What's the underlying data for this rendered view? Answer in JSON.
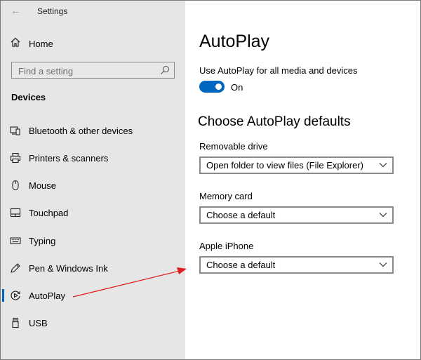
{
  "window": {
    "title": "Settings"
  },
  "sidebar": {
    "home_label": "Home",
    "search_placeholder": "Find a setting",
    "section_title": "Devices",
    "items": [
      {
        "label": "Bluetooth & other devices",
        "icon": "bluetooth-devices-icon"
      },
      {
        "label": "Printers & scanners",
        "icon": "printer-icon"
      },
      {
        "label": "Mouse",
        "icon": "mouse-icon"
      },
      {
        "label": "Touchpad",
        "icon": "touchpad-icon"
      },
      {
        "label": "Typing",
        "icon": "keyboard-icon"
      },
      {
        "label": "Pen & Windows Ink",
        "icon": "pen-icon"
      },
      {
        "label": "AutoPlay",
        "icon": "autoplay-icon",
        "active": true
      },
      {
        "label": "USB",
        "icon": "usb-icon"
      }
    ]
  },
  "main": {
    "title": "AutoPlay",
    "toggle": {
      "caption": "Use AutoPlay for all media and devices",
      "state_label": "On",
      "on": true
    },
    "defaults_heading": "Choose AutoPlay defaults",
    "fields": [
      {
        "label": "Removable drive",
        "value": "Open folder to view files (File Explorer)"
      },
      {
        "label": "Memory card",
        "value": "Choose a default"
      },
      {
        "label": "Apple iPhone",
        "value": "Choose a default"
      }
    ]
  },
  "colors": {
    "accent": "#0067c0",
    "sidebar_bg": "#e6e6e6",
    "annotation_arrow": "#e02020"
  }
}
